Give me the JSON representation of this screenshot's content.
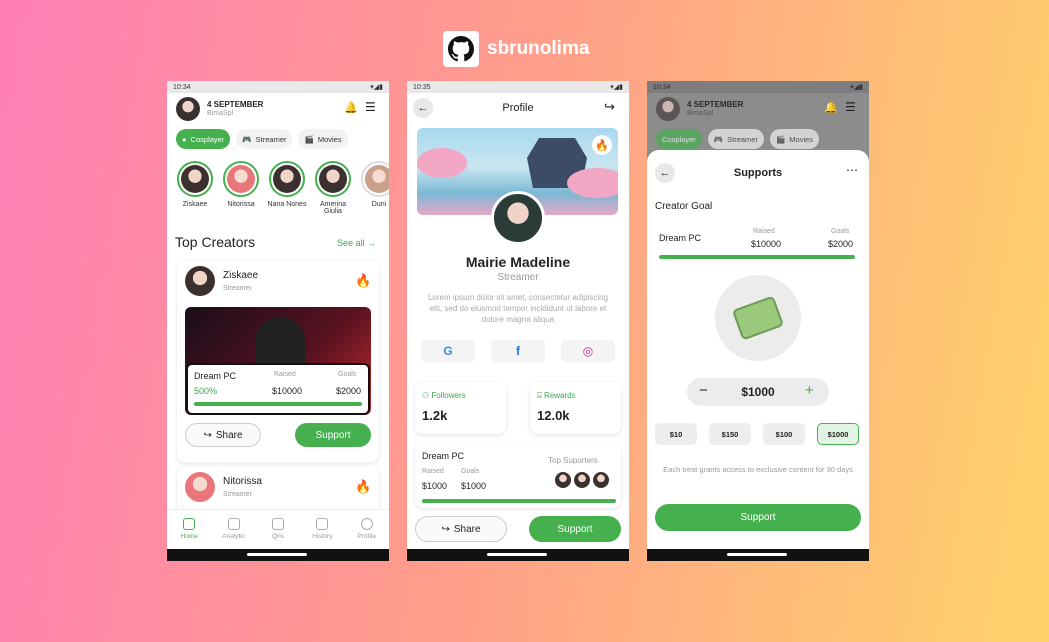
{
  "brand": {
    "name": "sbrunolima"
  },
  "status_time_1": "10:34",
  "status_time_2": "10:35",
  "status_time_3": "10:34",
  "home": {
    "date": "4 SEPTEMBER",
    "user": "BimaSpl",
    "chips": [
      {
        "label": "Cosplayer"
      },
      {
        "label": "Streamer"
      },
      {
        "label": "Movies"
      }
    ],
    "stories": [
      {
        "name": "Ziskaee"
      },
      {
        "name": "Nitorissa"
      },
      {
        "name": "Nana Nones"
      },
      {
        "name": "Amerina Giulia"
      },
      {
        "name": "Duni"
      }
    ],
    "section_title": "Top Creators",
    "see_all": "See all",
    "creator1": {
      "name": "Ziskaee",
      "role": "Streamer",
      "goal_name": "Dream PC",
      "percent": "500%",
      "raised_label": "Raised",
      "raised": "$10000",
      "goals_label": "Goals",
      "goals": "$2000",
      "progress": 1.0
    },
    "share": "Share",
    "support": "Support",
    "creator2": {
      "name": "Nitorissa",
      "role": "Streamer"
    },
    "tabs": [
      {
        "label": "Home"
      },
      {
        "label": "Analytic"
      },
      {
        "label": "Qris"
      },
      {
        "label": "History"
      },
      {
        "label": "Profile"
      }
    ]
  },
  "profile": {
    "title": "Profile",
    "name": "Mairie Madeline",
    "role": "Streamer",
    "bio": "Lorem ipsum dolor sit amet, consectetur adipiscing elit, sed do eiusmod tempor incididunt ut labore et dolore magna aliqua",
    "followers_label": "Followers",
    "followers": "1.2k",
    "rewards_label": "Rewards",
    "rewards": "12.0k",
    "goal_name": "Dream PC",
    "raised_label": "Raised",
    "raised": "$1000",
    "goals_label": "Goals",
    "goals": "$1000",
    "top_supporters": "Top Suporters",
    "progress": 1.0,
    "share": "Share",
    "support": "Support"
  },
  "supports": {
    "title": "Supports",
    "creator_goal": "Creator Goal",
    "goal_name": "Dream PC",
    "raised_label": "Raised",
    "raised": "$10000",
    "goals_label": "Goals",
    "goals": "$2000",
    "progress": 1.0,
    "amount": "$1000",
    "minus": "−",
    "plus": "+",
    "options": [
      "$10",
      "$150",
      "$100",
      "$1000"
    ],
    "note": "Each treat grants access to exclusive content for 30 days",
    "support": "Support"
  },
  "colors": {
    "accent": "#46b04f"
  }
}
